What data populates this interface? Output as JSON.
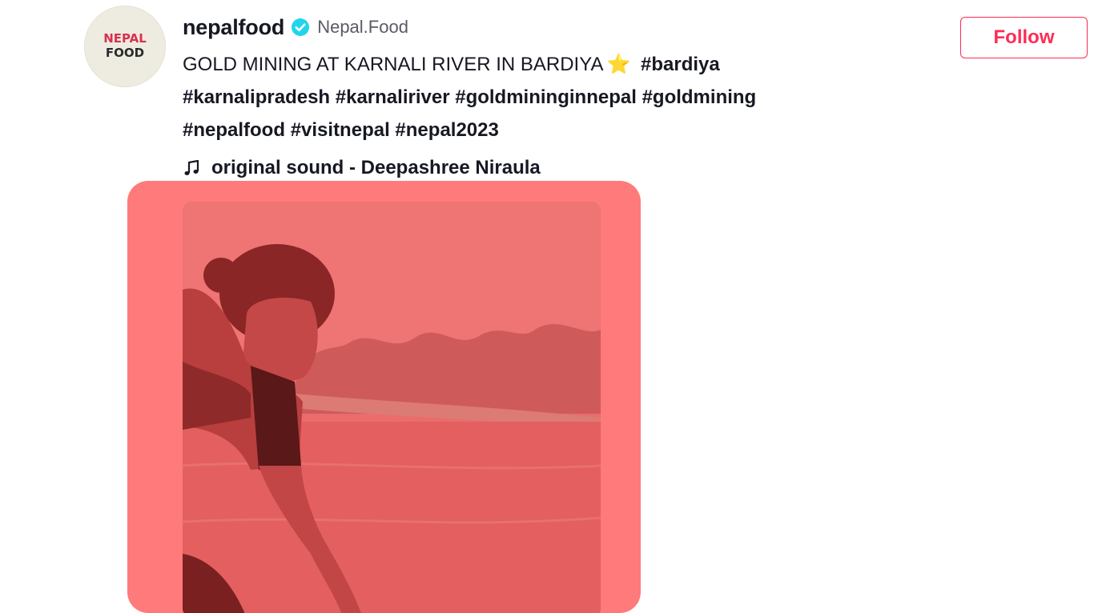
{
  "author": {
    "avatar_text_top": "NEPAL",
    "avatar_text_bottom": "FOOD",
    "unique_id": "nepalfood",
    "verified_icon": "verified-badge-icon",
    "nickname": "Nepal.Food"
  },
  "follow_button": {
    "label": "Follow"
  },
  "caption": {
    "text": "GOLD MINING AT KARNALI RIVER IN BARDIYA",
    "emoji": "⭐",
    "hashtags": [
      "#bardiya",
      "#karnalipradesh",
      "#karnaliriver",
      "#goldmininginnepal",
      "#goldmining",
      "#nepalfood",
      "#visitnepal",
      "#nepal2023"
    ]
  },
  "music": {
    "icon": "music-note-icon",
    "label": "original sound - Deepashree Niraula"
  },
  "colors": {
    "accent": "#fe2c55",
    "verified": "#20d5ec",
    "video_overlay": "#ff7a7a",
    "text": "#161823"
  }
}
